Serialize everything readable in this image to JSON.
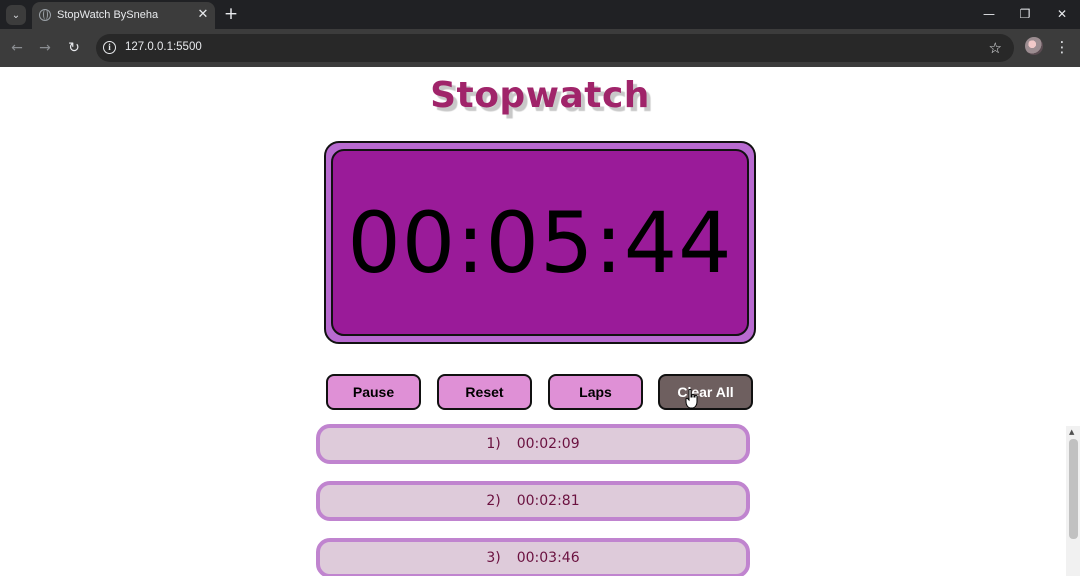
{
  "browser": {
    "tab_title": "StopWatch BySneha",
    "url": "127.0.0.1:5500",
    "icons": {
      "tab_list": "chevron-down-icon",
      "favicon": "globe-icon",
      "close": "close-icon",
      "new_tab": "plus-icon",
      "minimize": "minimize-icon",
      "restore": "restore-icon",
      "window_close": "close-icon",
      "back": "back-arrow-icon",
      "forward": "forward-arrow-icon",
      "reload": "reload-icon",
      "site_info": "info-icon",
      "bookmark": "star-icon",
      "profile": "avatar",
      "menu": "kebab-menu-icon"
    },
    "glyphs": {
      "tab_list": "⌄",
      "close": "✕",
      "new_tab": "+",
      "minimize": "—",
      "restore": "❐",
      "window_close": "✕",
      "back": "←",
      "forward": "→",
      "reload": "↻",
      "info": "i",
      "star": "☆",
      "menu": "⋮"
    }
  },
  "app": {
    "heading": "Stopwatch",
    "time": "00:05:44",
    "buttons": {
      "pause": "Pause",
      "reset": "Reset",
      "laps": "Laps",
      "clear_all": "Clear All"
    },
    "laps": [
      {
        "index": "1)",
        "time": "00:02:09"
      },
      {
        "index": "2)",
        "time": "00:02:81"
      },
      {
        "index": "3)",
        "time": "00:03:46"
      }
    ]
  },
  "colors": {
    "heading": "#a0246a",
    "display_outer": "#b86ad0",
    "display_inner": "#9a1b99",
    "button": "#df90d6",
    "button_active": "#6e5f5f",
    "lap_bg": "#decbda",
    "lap_border": "#c084cf",
    "lap_text": "#6b1240"
  }
}
